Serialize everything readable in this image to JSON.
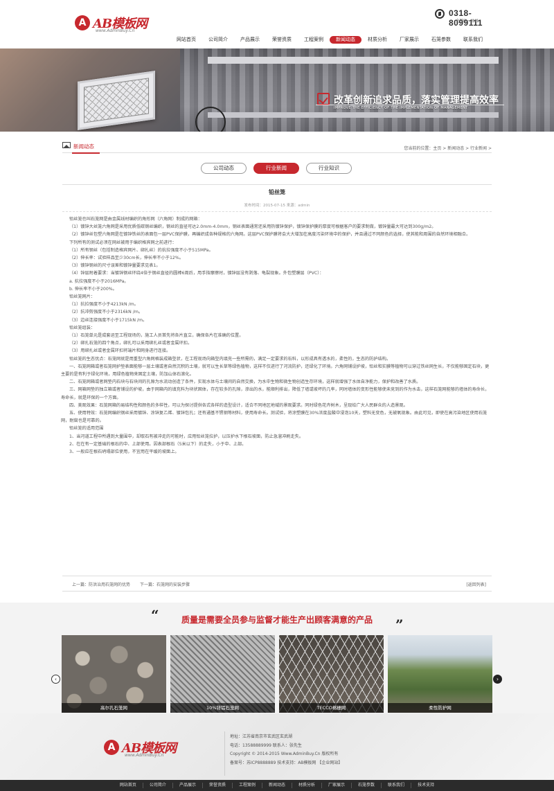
{
  "header": {
    "logo_letter": "A",
    "logo_text": "AB模板网",
    "logo_sub": "www.AdminBuy.Cn",
    "phone": "0318-8099111",
    "phone_sub": "全国统一热线"
  },
  "nav": {
    "items": [
      "网站首页",
      "公司简介",
      "产品展示",
      "荣誉资质",
      "工程案例",
      "新闻动态",
      "材质分析",
      "厂家展示",
      "石笼参数",
      "联系我们"
    ],
    "active_index": 5
  },
  "banner": {
    "slogan": "改革创新追求品质，落实管理提高效率",
    "slogan_sub": "IMPROVE THE EFFICIENCY OF THE IMPLEMENTATION OF MANAGEMENT"
  },
  "section": {
    "title": "新闻动态",
    "breadcrumb": "您当前的位置：主页 > 新闻动态 > 行业新闻 >"
  },
  "tabs": [
    "公司动态",
    "行业新闻",
    "行业知识"
  ],
  "article": {
    "title": "铅丝笼",
    "meta": "发布时间：2015-07-15   来源：admin",
    "paragraphs": [
      "铅丝笼也叫石笼网是由金属线材编织的角形网（六角网）制成的网箱：",
      "（1）镀锌大丝笼六角网是采用优质低碳钢丝编织，钢丝的直径可达2.0mm-4.0mm，钢丝表面通常还采用热镀锌保护，镀锌保护膜的厚度可根据客户的要求制做，镀锌量最大可达到300g/m2。",
      "（2）镀锌丝包塑六角网是在镀锌铁丝的表面包一层PVC保护膜，再编织成各种规格的六角网。这层PVC保护膜将会大大增加在高度污染环境中的保护，并且通过不同颜色的选择，使其能和周围的自然环境相融合。",
      "下列所有的测试必须在网丝被用于编织格宾网之前进行：",
      "（1）所有钢丝（包括制造格宾网片、绑扎丝）的抗拉强度不小于515MPa。",
      "（2）伸长率：试验样品至少30cm长，伸长率不小于12%。",
      "（3）镀锌钢丝的尺寸误差和镀锌量要求见表1。",
      "（4）锌层附着要求：当镀锌钢丝环绕4倍于钢丝直径的圆棒6周后，用手指摩擦时，镀锌层没有剥落、龟裂现象。外包塑膜层（PVC）：",
      "a. 抗拉强度不小于2016MPa。",
      "b. 伸长率不小于200%。",
      "铅丝笼网片：",
      "（1）抗拉强度不小于4213kN /m。",
      "（2）抗冲剪强度不小于2316kN /m。",
      "（3）边丝连接强度不小于1715kN /m。",
      "铅丝笼组装：",
      "（1）石笼单元是成套运至工程现场的，施工人员首先将各片直立，确保各片在准确的位置。",
      "（2）绑扎石笼的四个角点，绑扎可以采用绑扎丝或者金属环扣。",
      "（3）用绑扎丝或者金属环扣将端片和网身进行连接。",
      "铅丝笼的生态优点：石笼网就是用重型六角网格装成箱型状，在工程现场向箱型内填充一些所需的，满足一定要求的石料，以形成具有透水的，柔性的，生态的防护结构。",
      "一、石笼网箱或者石笼网护垫表面能够一层土壤或者自然沉积的土壤，就可以生长草等绿色植物，这样不仅进行了河流防护，还绿化了环境。六角网铺设护坡，铅丝和实膜等植物可以穿过铁丝网生长，不仅能够固定石块，更主要的是有利于绿化环境，用绿色植物来固定土壤，防加山体石滚化。",
      "二、石笼网箱或者网垫内石块与石块间的孔隙为水流动创造了条件，实现水体与土壤间的自然交换，为水中生物和微生物创造生存环境，这样就增强了水体自净能力，保护和改善了水质。",
      "三、网箱网垫的独立箱或者铺设的护坡，由于网箱内的填充料为块状固体，存在较多的孔隙，渗出的水，能顺利排出，降低了墙或坡坏的几率，同时墙体的变形性能够使未竞到的作为水击，这样石笼网能够的墙体的寿命长，寿命长，就是环保的一个方面。",
      "四、美观效果：石笼网箱的易结构性和颜色的多样性，可以为探讨提供各式各样的造型设计，适合不同地区地域的景观要求。同时绿色花卉树木，呈现给广大人民群众的人造景观。",
      "五、使用特效：石笼网编织钢丝采用镀锌、涂锌复乙烯、镀锌包孔；还有通基不锈钢等材料，使用寿命长。测试验，将涂塑膜在30%浓度盐酸中浸泡10天，塑料无变色，无被氧现象。由此可见，即使在高污染地区使用石笼网，耐腐也是可靠的。",
      "铅丝笼的适用范围",
      "1、当河道工程中所遇到大量围中，却取石有被冲走的可能时，应用铅丝笼拉护，以压护水下根石坡面，防止急溜冲刷走失。",
      "2、在在有一定基础的根石的中、上部使用。因表部根石（5米以下）的走失，小于中、上部。",
      "3、一般应在根石坍塌部位使用，不宜用在平缓的坡面上。"
    ],
    "indent_flags": [
      true,
      true,
      true,
      true,
      true,
      true,
      true,
      true,
      true,
      true,
      true,
      true,
      true,
      true,
      true,
      true,
      true,
      true,
      true,
      true,
      true,
      true,
      true,
      true,
      true,
      true,
      true,
      true
    ]
  },
  "pager": {
    "prev": "上一篇：防洪治用石笼网的优势",
    "next": "下一篇：石笼网的安装步骤",
    "back": "[返回列表]"
  },
  "quality": {
    "quote_left": "“",
    "quote_right": "”",
    "title": "质量是需要全员参与监督才能生产出顾客满意的产品",
    "products": [
      "高尔孔石笼网",
      "10%锌铝石笼网",
      "TECCO格栅网",
      "柔性防护网"
    ],
    "prev_arrow": "‹",
    "next_arrow": "›"
  },
  "footer": {
    "info": [
      "地址：江苏省南京市玄武区玄武湖",
      "电话：13588889999  联系人：张先生",
      "Copyright © 2014-2015 Www.AdminBuy.Cn 版权所有",
      "备案号：苏ICP8888889    技术支持：AB模板网  【企业网站】"
    ],
    "bottom_nav": [
      "网站首页",
      "公司简介",
      "产品展示",
      "荣誉资质",
      "工程案例",
      "新闻动态",
      "材质分析",
      "厂家展示",
      "石笼参数",
      "联系我们",
      "技术支持"
    ]
  },
  "colors": {
    "accent": "#c7282e",
    "dark_bar": "#2b2b2b"
  }
}
